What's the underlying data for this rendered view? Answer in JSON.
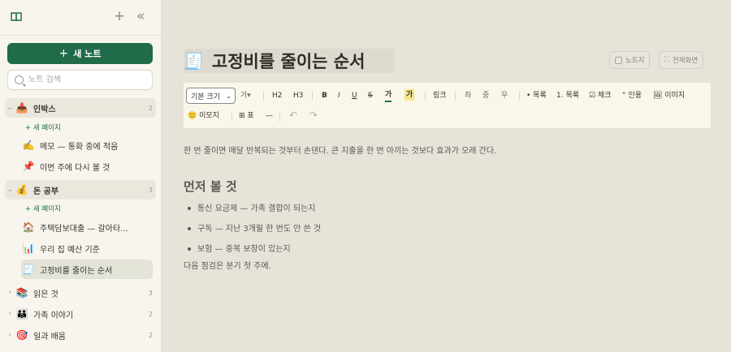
{
  "sidebar": {
    "new_note_label": "새 노트",
    "search_placeholder": "노트 검색",
    "new_page_label": "+ 새 페이지",
    "folders": [
      {
        "emoji": "📥",
        "label": "인박스",
        "count": "2",
        "items": [
          {
            "emoji": "✍️",
            "label": "메모 — 통화 중에 적음"
          },
          {
            "emoji": "📌",
            "label": "이번 주에 다시 볼 것"
          }
        ]
      },
      {
        "emoji": "💰",
        "label": "돈 공부",
        "count": "3",
        "items": [
          {
            "emoji": "🏠",
            "label": "주택담보대출 — 갈아타..."
          },
          {
            "emoji": "📊",
            "label": "우리 집 예산 기준"
          },
          {
            "emoji": "🧾",
            "label": "고정비를 줄이는 순서"
          }
        ]
      },
      {
        "emoji": "📚",
        "label": "읽은 것",
        "count": "3"
      },
      {
        "emoji": "👪",
        "label": "가족 이야기",
        "count": "2"
      },
      {
        "emoji": "🎯",
        "label": "일과 배움",
        "count": "2"
      }
    ]
  },
  "page": {
    "emoji": "🧾",
    "title": "고정비를 줄이는 순서",
    "btn_notebook": "노트지",
    "btn_fullscreen": "전체화면"
  },
  "toolbar": {
    "size_select": "기본 크기",
    "font_btn": "가",
    "h2": "H2",
    "h3": "H3",
    "bold": "B",
    "italic": "I",
    "underline": "U",
    "strike": "S",
    "color": "가",
    "highlight": "가",
    "link": "링크",
    "align_left": "좌",
    "align_center": "중",
    "align_right": "우",
    "list": "• 목록",
    "ordered": "1. 목록",
    "check": "☑ 체크",
    "quote": "“ 인용",
    "image": "🖼 이미지",
    "emoji": "🙂 이모지",
    "table": "⊞ 표",
    "hr": "—",
    "undo": "↶",
    "redo": "↷"
  },
  "content": {
    "intro": "한 번 줄이면 매달 반복되는 것부터 손댄다. 큰 지출을 한 번 아끼는 것보다 효과가 오래 간다.",
    "heading": "먼저 볼 것",
    "bullets": [
      "통신 요금제 — 가족 결합이 되는지",
      "구독 — 지난 3개월 한 번도 안 쓴 것",
      "보험 — 중복 보장이 있는지"
    ],
    "footer": "다음 점검은 분기 첫 주에."
  },
  "colors": {
    "accent": "#1f6b4a",
    "text_color_swatch": "#1f6b4a",
    "highlight_swatch": "#f5e58a"
  }
}
